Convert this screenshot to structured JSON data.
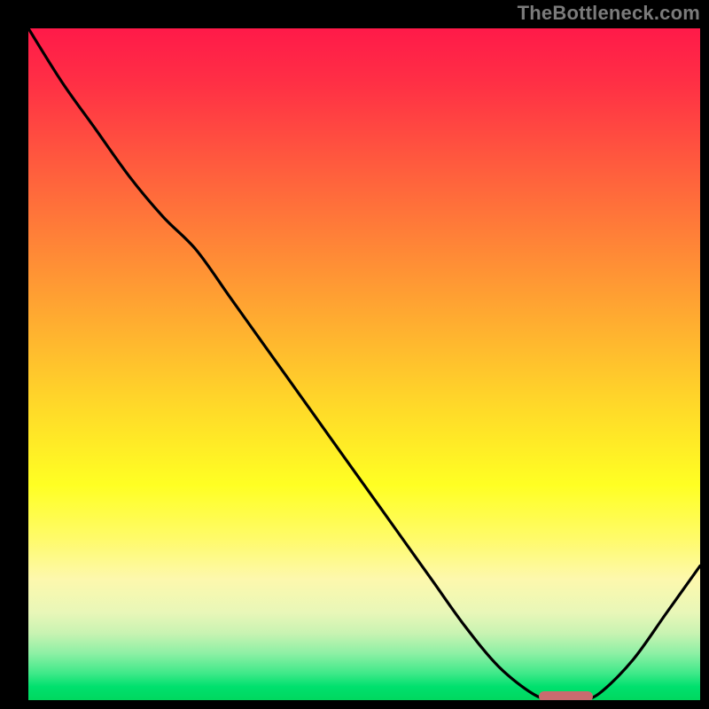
{
  "watermark": "TheBottleneck.com",
  "colors": {
    "frame": "#000000",
    "curve": "#000000",
    "marker": "#c96b6f",
    "gradient_stops": [
      "#ff1a49",
      "#ff2f45",
      "#ff5a3e",
      "#ff8437",
      "#ffae30",
      "#ffd829",
      "#ffff23",
      "#fffb6a",
      "#fdf8ad",
      "#e8f7b8",
      "#c9f3b2",
      "#8ef0a5",
      "#3fe989",
      "#00e06e",
      "#00d85f"
    ]
  },
  "chart_data": {
    "type": "line",
    "title": "",
    "xlabel": "",
    "ylabel": "",
    "xlim": [
      0,
      100
    ],
    "ylim": [
      0,
      100
    ],
    "x": [
      0,
      5,
      10,
      15,
      20,
      25,
      30,
      35,
      40,
      45,
      50,
      55,
      60,
      65,
      70,
      75,
      78,
      82,
      85,
      90,
      95,
      100
    ],
    "values": [
      100,
      92,
      85,
      78,
      72,
      67,
      60,
      53,
      46,
      39,
      32,
      25,
      18,
      11,
      5,
      1,
      0,
      0,
      1,
      6,
      13,
      20
    ],
    "marker": {
      "x_start": 76,
      "x_end": 84,
      "y": 0.5
    },
    "note": "Values are read off the gradient zones: y=0 is the green baseline, y=100 is the top (red). The curve starts at the top-left, bends slightly near x≈20, descends roughly linearly to a flat minimum around x≈76–84 (at the marker), then rises toward the right edge."
  }
}
